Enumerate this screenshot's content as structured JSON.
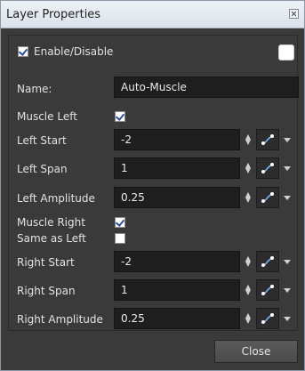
{
  "window": {
    "title": "Layer Properties"
  },
  "enable": {
    "label": "Enable/Disable",
    "checked": true
  },
  "name": {
    "label": "Name:",
    "value": "Auto-Muscle"
  },
  "muscle_left": {
    "label": "Muscle Left",
    "checked": true
  },
  "left_start": {
    "label": "Left Start",
    "value": "-2"
  },
  "left_span": {
    "label": "Left Span",
    "value": "1"
  },
  "left_amplitude": {
    "label": "Left Amplitude",
    "value": "0.25"
  },
  "muscle_right": {
    "label": "Muscle Right",
    "checked": true
  },
  "same_as_left": {
    "label": "Same as Left",
    "checked": false
  },
  "right_start": {
    "label": "Right Start",
    "value": "-2"
  },
  "right_span": {
    "label": "Right Span",
    "value": "1"
  },
  "right_amplitude": {
    "label": "Right Amplitude",
    "value": "0.25"
  },
  "footer": {
    "close_label": "Close"
  },
  "icons": {
    "spinner": "spinner-arrows-icon",
    "function": "function-curve-icon",
    "menu": "chevron-down-icon"
  },
  "colors": {
    "panel_bg": "#3a3a3a",
    "field_bg": "#1e1e1e",
    "text": "#e2e2e2"
  }
}
